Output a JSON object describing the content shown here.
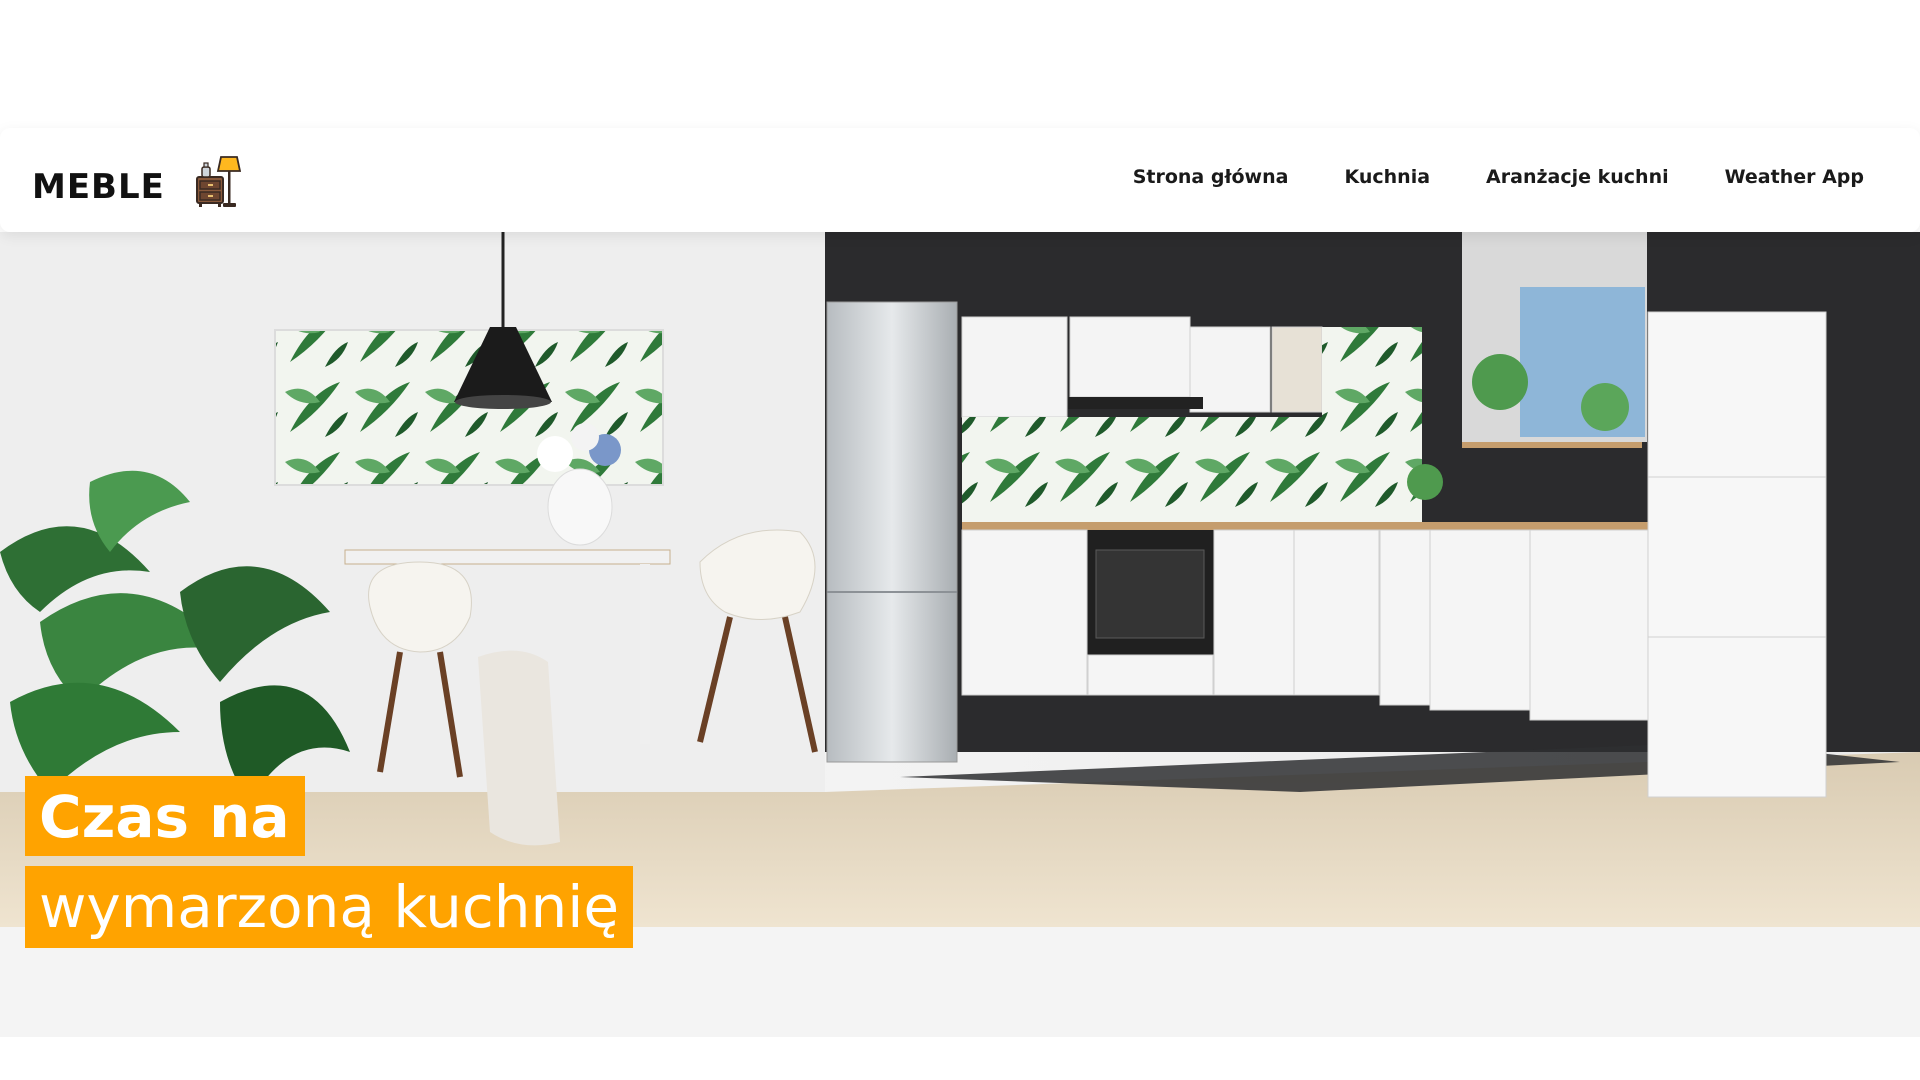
{
  "header": {
    "logo_text": "MEBLE",
    "logo_icon": "nightstand-lamp-icon",
    "nav": [
      {
        "label": "Strona główna"
      },
      {
        "label": "Kuchnia"
      },
      {
        "label": "Aranżacje kuchni"
      },
      {
        "label": "Weather App"
      }
    ]
  },
  "hero": {
    "image": "kitchen-interior-photo",
    "caption_line1": "Czas na",
    "caption_line2": "wymarzoną kuchnię"
  },
  "colors": {
    "accent": "#ffa300",
    "header_bg": "#ffffff",
    "text": "#111111",
    "footer_strip": "#f4f4f4"
  }
}
